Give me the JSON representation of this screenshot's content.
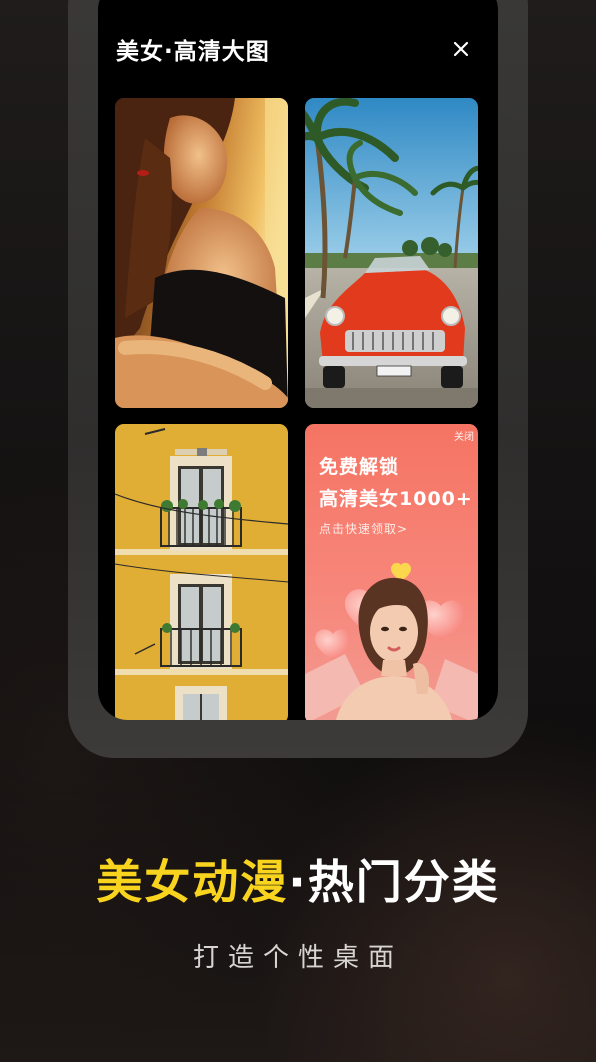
{
  "popup": {
    "title": "美女·高清大图",
    "close_icon": "close-icon"
  },
  "gallery": {
    "tiles": [
      {
        "subject": "woman-portrait"
      },
      {
        "subject": "red-classic-car-palm-trees"
      },
      {
        "subject": "yellow-building-balconies"
      }
    ],
    "ad": {
      "close_label": "关闭",
      "line1": "免费解锁",
      "line2": "高清美女1000+",
      "cta": "点击快速领取>"
    }
  },
  "promo": {
    "headline_highlight": "美女动漫",
    "headline_rest": "·热门分类",
    "subheadline": "打造个性桌面",
    "highlight_color": "#f9d41f"
  }
}
